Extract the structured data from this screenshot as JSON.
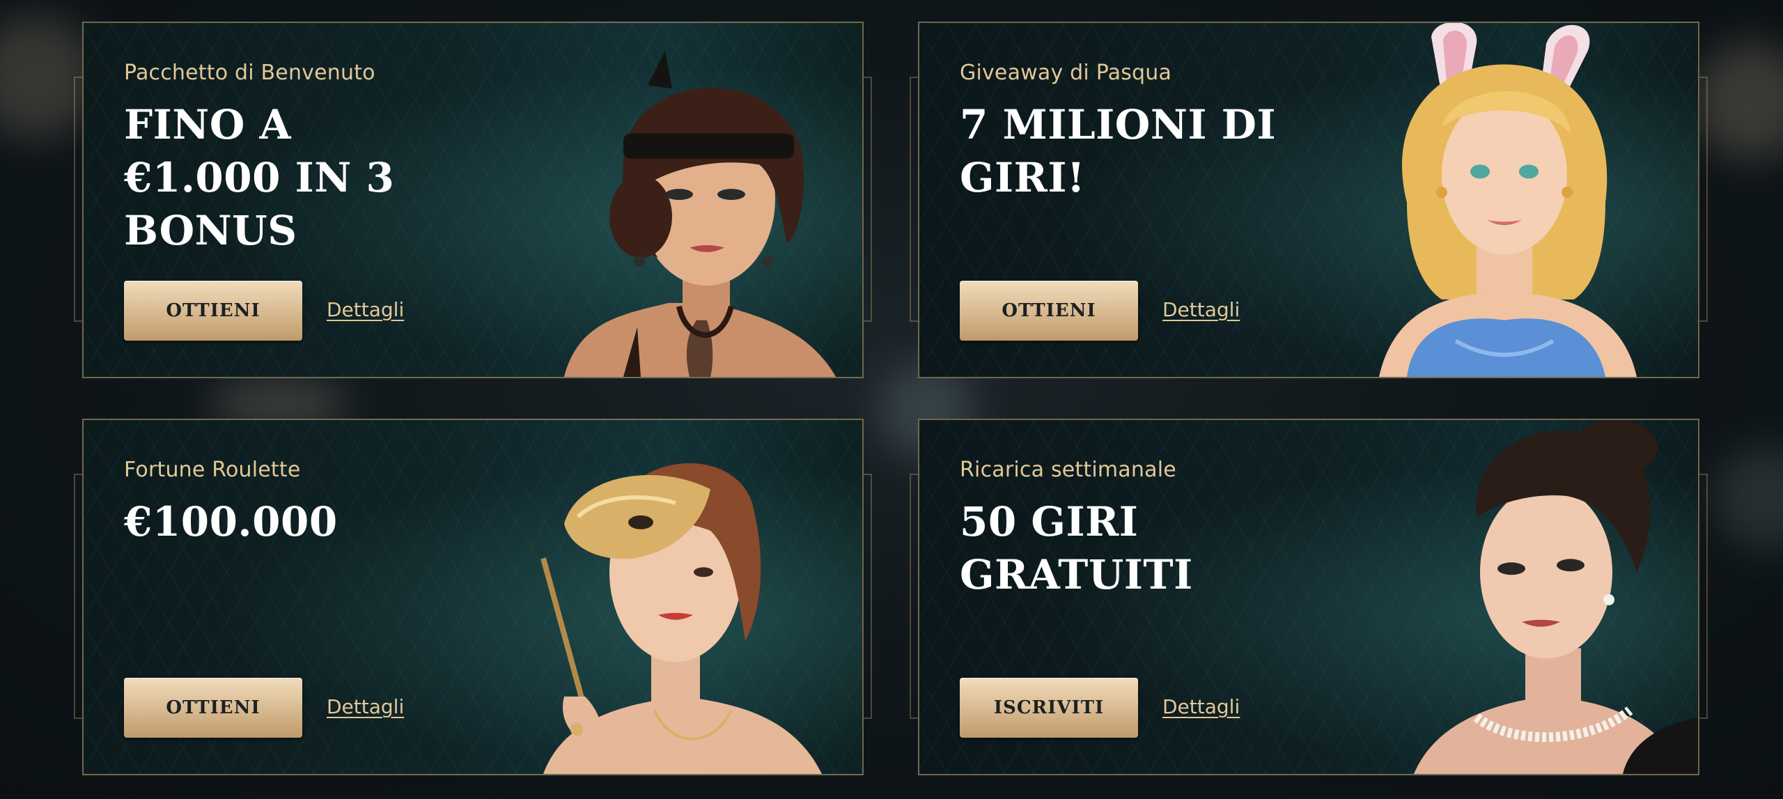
{
  "promotions": [
    {
      "eyebrow": "Pacchetto di Benvenuto",
      "headline_lines": [
        "FINO A",
        "€1.000 IN 3",
        "BONUS"
      ],
      "cta": "OTTIENI",
      "details": "Dettagli",
      "artwork": "flapper-woman-headband-illustration"
    },
    {
      "eyebrow": "Giveaway di Pasqua",
      "headline_lines": [
        "7 MILIONI DI",
        "GIRI!"
      ],
      "cta": "OTTIENI",
      "details": "Dettagli",
      "artwork": "blonde-bunny-ears-woman-illustration"
    },
    {
      "eyebrow": "Fortune Roulette",
      "headline_lines": [
        "€100.000"
      ],
      "cta": "OTTIENI",
      "details": "Dettagli",
      "artwork": "woman-with-masquerade-mask-illustration"
    },
    {
      "eyebrow": "Ricarica settimanale",
      "headline_lines": [
        "50 GIRI",
        "GRATUITI"
      ],
      "cta": "ISCRIVITI",
      "details": "Dettagli",
      "artwork": "woman-pearl-necklace-illustration"
    }
  ],
  "colors": {
    "accent_gold": "#e2c898",
    "button_gradient_top": "#f1dcbc",
    "button_gradient_bottom": "#c09a6b",
    "card_teal": "#133235",
    "page_background": "#10171b"
  }
}
